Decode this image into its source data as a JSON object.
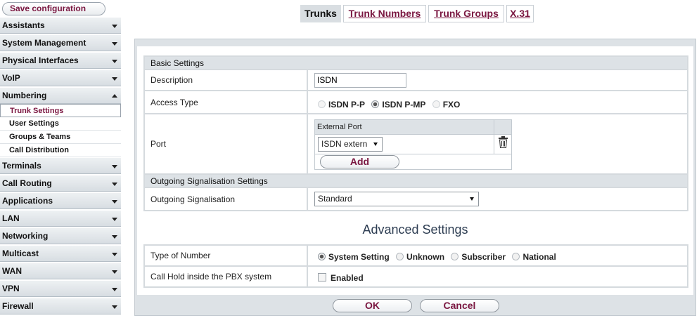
{
  "sidebar": {
    "save_label": "Save configuration",
    "menus": [
      "Assistants",
      "System Management",
      "Physical Interfaces",
      "VoIP",
      "Numbering",
      "Terminals",
      "Call Routing",
      "Applications",
      "LAN",
      "Networking",
      "Multicast",
      "WAN",
      "VPN",
      "Firewall"
    ],
    "numbering_items": [
      "Trunk Settings",
      "User Settings",
      "Groups & Teams",
      "Call Distribution"
    ],
    "active_item": "Trunk Settings"
  },
  "tabs": [
    "Trunks",
    "Trunk Numbers",
    "Trunk Groups",
    "X.31"
  ],
  "basic": {
    "section_title": "Basic Settings",
    "description_label": "Description",
    "description_value": "ISDN",
    "access_type_label": "Access Type",
    "access_options": [
      "ISDN P-P",
      "ISDN P-MP",
      "FXO"
    ],
    "access_selected": "ISDN P-MP",
    "port_label": "Port",
    "external_port_header": "External Port",
    "external_port_value": "ISDN extern",
    "delete_icon": "trash-icon",
    "add_label": "Add"
  },
  "outgoing": {
    "section_title": "Outgoing Signalisation Settings",
    "label": "Outgoing Signalisation",
    "value": "Standard"
  },
  "advanced": {
    "title": "Advanced Settings",
    "type_of_number_label": "Type of Number",
    "type_options": [
      "System Setting",
      "Unknown",
      "Subscriber",
      "National"
    ],
    "type_selected": "System Setting",
    "call_hold_label": "Call Hold inside the PBX system",
    "call_hold_option": "Enabled",
    "call_hold_checked": false
  },
  "footer": {
    "ok_label": "OK",
    "cancel_label": "Cancel"
  },
  "colors": {
    "accent": "#7a1640",
    "panel_bg": "#dde2e6"
  }
}
